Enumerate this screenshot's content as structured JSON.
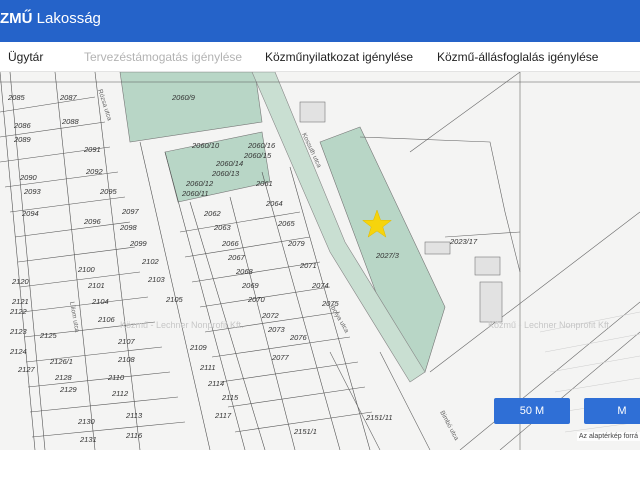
{
  "app": {
    "brand_bold": "ZMŰ",
    "brand_light": " Lakosság"
  },
  "tabs": [
    {
      "label": "Ügytár",
      "disabled": false
    },
    {
      "label": "Tervezéstámogatás igénylése",
      "disabled": true
    },
    {
      "label": "Közműnyilatkozat igénylése",
      "disabled": false
    },
    {
      "label": "Közmű-állásfoglalás igénylése",
      "disabled": false
    }
  ],
  "map": {
    "marker_icon": "star-icon",
    "marker_color": "#f6d40c",
    "highlight_color": "#b8d6c6",
    "parcel_labels": [
      "2085",
      "2087",
      "2086",
      "2088",
      "2089",
      "2091",
      "2090",
      "2092",
      "2093",
      "2095",
      "2094",
      "2096",
      "2097",
      "2098",
      "2099",
      "2100",
      "2101",
      "2102",
      "2103",
      "2104",
      "2105",
      "2106",
      "2107",
      "2108",
      "2109",
      "2110",
      "2111",
      "2112",
      "2113",
      "2114",
      "2115",
      "2116",
      "2117",
      "2118",
      "2119",
      "2120",
      "2121",
      "2122",
      "2123",
      "2124",
      "2125",
      "2126/1",
      "2127",
      "2128",
      "2129",
      "2130",
      "2131",
      "2060/9",
      "2060/10",
      "2060/16",
      "2060/15",
      "2060/14",
      "2060/13",
      "2060/12",
      "2060/11",
      "2061",
      "2062",
      "2063",
      "2064",
      "2065",
      "2066",
      "2067",
      "2068",
      "2069",
      "2070",
      "2071",
      "2072",
      "2073",
      "2074",
      "2075",
      "2076",
      "2077",
      "2079",
      "2027/3",
      "2023/17",
      "2151/1",
      "2151/11"
    ],
    "watermarks": [
      "Közmű - Lechner Nonprofit Kft.",
      "Közmű - Lechner Nonprofit Kft"
    ],
    "street_labels": [
      "Kossuth utca",
      "Rózsa utca",
      "Liliom utca",
      "Ibolya utca",
      "Bimbó utca"
    ]
  },
  "scale_buttons": [
    "50 M",
    "M"
  ],
  "attribution": "Az alaptérkép forrá"
}
